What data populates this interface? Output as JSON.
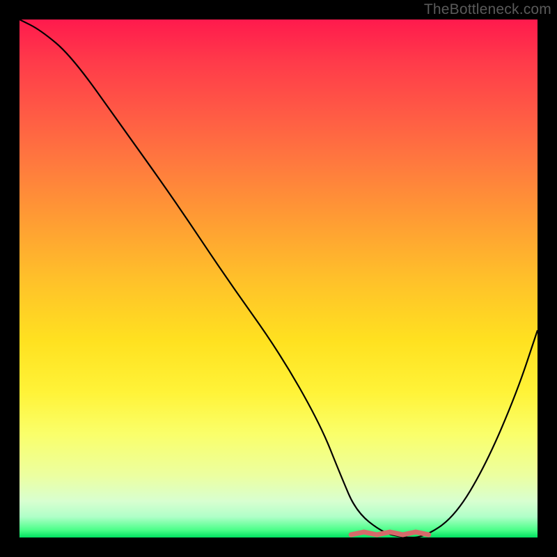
{
  "watermark": "TheBottleneck.com",
  "chart_data": {
    "type": "line",
    "title": "",
    "xlabel": "",
    "ylabel": "",
    "xlim": [
      0,
      100
    ],
    "ylim": [
      0,
      100
    ],
    "series": [
      {
        "name": "bottleneck-curve",
        "x": [
          0,
          4,
          10,
          20,
          30,
          40,
          50,
          58,
          62,
          65,
          70,
          74,
          78,
          84,
          90,
          96,
          100
        ],
        "values": [
          100,
          98,
          93,
          79,
          65,
          50,
          36,
          22,
          12,
          5,
          1,
          0,
          0,
          4,
          14,
          28,
          40
        ]
      }
    ],
    "highlight": {
      "name": "flat-minimum",
      "x_start": 64,
      "x_end": 79,
      "color": "#d66a6a"
    },
    "gradient_stops": [
      {
        "pos": 0,
        "color": "#ff1a4d"
      },
      {
        "pos": 50,
        "color": "#ffc02a"
      },
      {
        "pos": 80,
        "color": "#faff6a"
      },
      {
        "pos": 100,
        "color": "#00e060"
      }
    ]
  }
}
